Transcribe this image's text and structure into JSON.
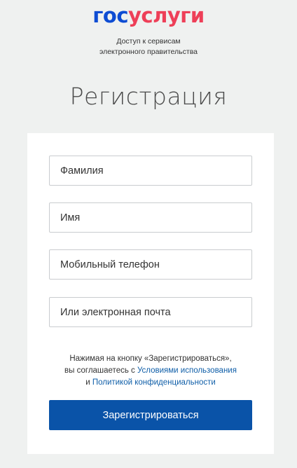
{
  "header": {
    "logo_part1": "гос",
    "logo_part2": "услуги",
    "tagline_line1": "Доступ к сервисам",
    "tagline_line2": "электронного правительства"
  },
  "form": {
    "title": "Регистрация",
    "fields": [
      {
        "placeholder": "Фамилия",
        "value": ""
      },
      {
        "placeholder": "Имя",
        "value": ""
      },
      {
        "placeholder": "Мобильный телефон",
        "value": ""
      },
      {
        "placeholder": "Или электронная почта",
        "value": ""
      }
    ],
    "agreement": {
      "line1": "Нажимая на кнопку «Зарегистрироваться»,",
      "line2_prefix": "вы соглашаетесь с ",
      "terms_link": "Условиями использования",
      "line3_prefix": "и ",
      "privacy_link": "Политикой конфиденциальности"
    },
    "submit_label": "Зарегистрироваться"
  },
  "colors": {
    "logo_gos": "#0d4cd3",
    "logo_uslugi": "#ee3f58",
    "button": "#0a53a8",
    "link": "#0f5ea8",
    "background": "#eff1f0"
  }
}
